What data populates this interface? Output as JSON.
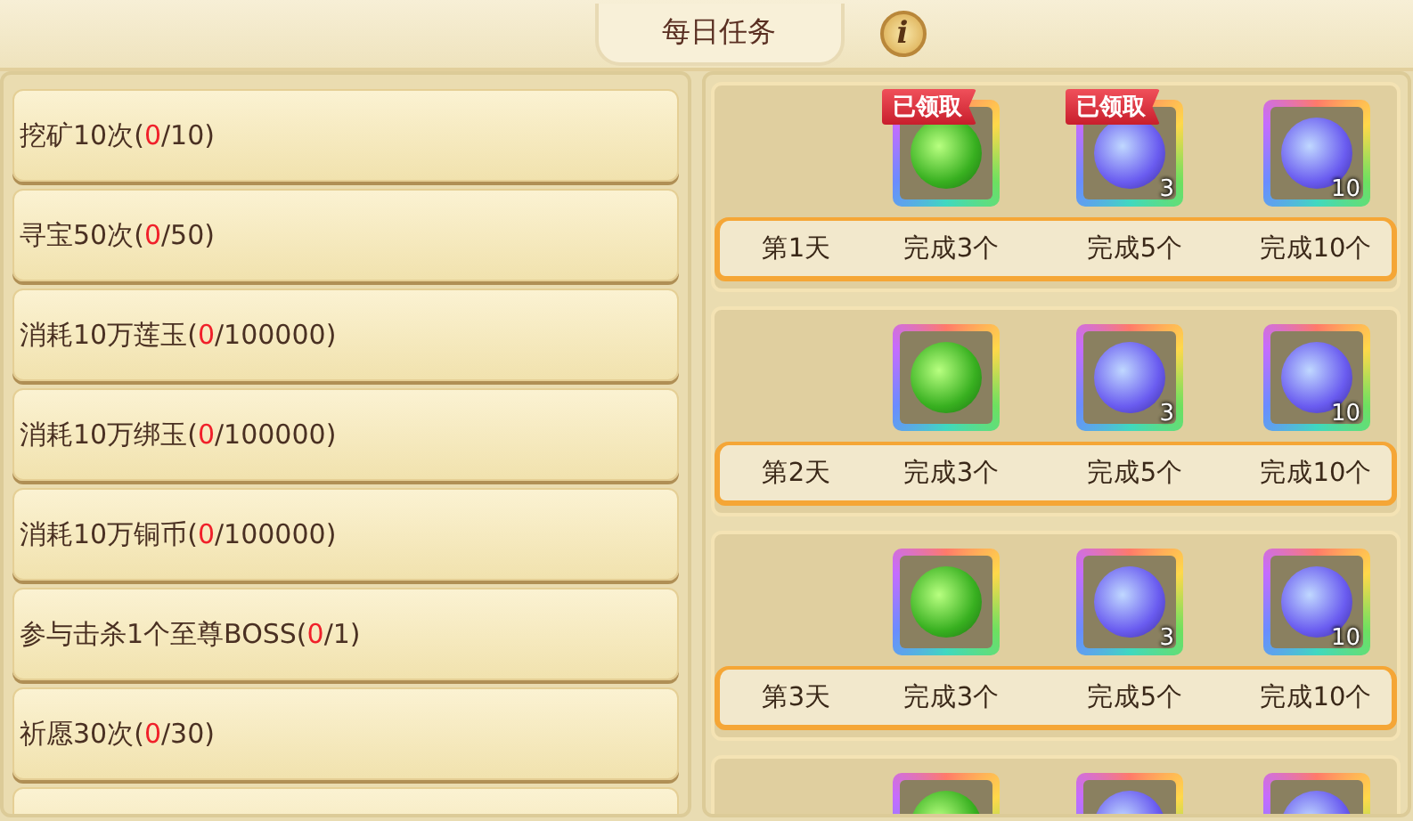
{
  "header": {
    "title": "每日任务",
    "info_icon": "i"
  },
  "tasks": [
    {
      "label": "挖矿10次(",
      "done": "0",
      "rest": "/10)"
    },
    {
      "label": "寻宝50次(",
      "done": "0",
      "rest": "/50)"
    },
    {
      "label": "消耗10万莲玉(",
      "done": "0",
      "rest": "/100000)"
    },
    {
      "label": "消耗10万绑玉(",
      "done": "0",
      "rest": "/100000)"
    },
    {
      "label": "消耗10万铜币(",
      "done": "0",
      "rest": "/100000)"
    },
    {
      "label": "参与击杀1个至尊BOSS(",
      "done": "0",
      "rest": "/1)"
    },
    {
      "label": "祈愿30次(",
      "done": "0",
      "rest": "/30)"
    }
  ],
  "days": [
    {
      "label": "第1天",
      "rewards": [
        {
          "label": "完成3个",
          "kind": "green",
          "claimed": true,
          "badge": "已领取"
        },
        {
          "label": "完成5个",
          "kind": "blue",
          "count": "3",
          "claimed": true,
          "badge": "已领取"
        },
        {
          "label": "完成10个",
          "kind": "blue",
          "count": "10",
          "claimed": false
        }
      ]
    },
    {
      "label": "第2天",
      "rewards": [
        {
          "label": "完成3个",
          "kind": "green",
          "claimed": false
        },
        {
          "label": "完成5个",
          "kind": "blue",
          "count": "3",
          "claimed": false
        },
        {
          "label": "完成10个",
          "kind": "blue",
          "count": "10",
          "claimed": false
        }
      ]
    },
    {
      "label": "第3天",
      "rewards": [
        {
          "label": "完成3个",
          "kind": "green",
          "claimed": false
        },
        {
          "label": "完成5个",
          "kind": "blue",
          "count": "3",
          "claimed": false
        },
        {
          "label": "完成10个",
          "kind": "blue",
          "count": "10",
          "claimed": false
        }
      ]
    },
    {
      "rewards": [
        {
          "kind": "green"
        },
        {
          "kind": "blue"
        },
        {
          "kind": "blue"
        }
      ]
    }
  ]
}
